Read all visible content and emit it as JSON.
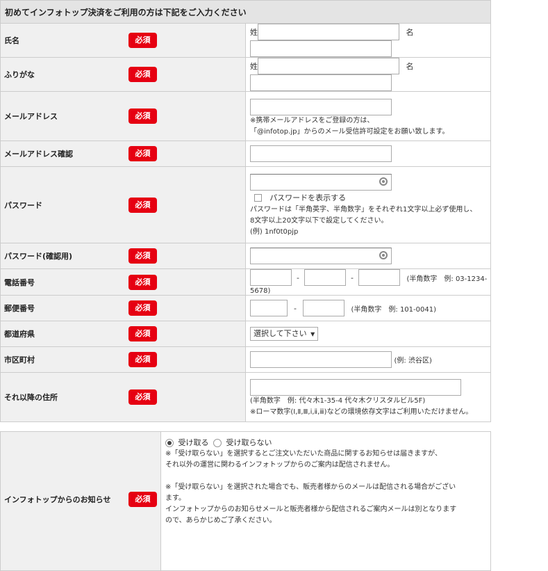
{
  "header": "初めてインフォトップ決済をご利用の方は下記をご入力ください",
  "required_label": "必須",
  "fields": {
    "name": {
      "label": "氏名",
      "last": "姓",
      "first": "名"
    },
    "kana": {
      "label": "ふりがな",
      "last": "姓",
      "first": "名"
    },
    "email": {
      "label": "メールアドレス",
      "note1": "※携帯メールアドレスをご登録の方は、",
      "note2": "「@infotop.jp」からのメール受信許可設定をお願い致します。"
    },
    "email_confirm": {
      "label": "メールアドレス確認"
    },
    "password": {
      "label": "パスワード",
      "show_label": "パスワードを表示する",
      "note1": "パスワードは「半角英字、半角数字」をそれぞれ1文字以上必ず使用し、",
      "note2": "8文字以上20文字以下で設定してください。",
      "note3": "(例) 1nf0t0pjp"
    },
    "password_confirm": {
      "label": "パスワード(確認用)"
    },
    "phone": {
      "label": "電話番号",
      "dash": "-",
      "note": "(半角数字　例: 03-1234-5678)"
    },
    "postal": {
      "label": "郵便番号",
      "dash": "-",
      "note": "(半角数字　例: 101-0041)"
    },
    "prefecture": {
      "label": "都道府県",
      "selected": "選択して下さい",
      "arrow": "▼"
    },
    "city": {
      "label": "市区町村",
      "note": "(例: 渋谷区)"
    },
    "address": {
      "label": "それ以降の住所",
      "note1": "(半角数字　例: 代々木1-35-4 代々木クリスタルビル5F)",
      "note2": "※ローマ数字(Ⅰ,Ⅱ,Ⅲ,ⅰ,ⅱ,ⅲ)などの環境依存文字はご利用いただけません。"
    }
  },
  "newsletter": {
    "label": "インフォトップからのお知らせ",
    "option_yes": "受け取る",
    "option_no": "受け取らない",
    "note1": "※「受け取らない」を選択するとご注文いただいた商品に関するお知らせは届きますが、",
    "note2": "それ以外の運営に関わるインフォトップからのご案内は配信されません。",
    "note3": "※「受け取らない」を選択された場合でも、販売者様からのメールは配信される場合がござい",
    "note4": "ます。",
    "note5": "インフォトップからのお知らせメールと販売者様から配信されるご案内メールは別となります",
    "note6": "ので、あらかじめご了承ください。"
  }
}
